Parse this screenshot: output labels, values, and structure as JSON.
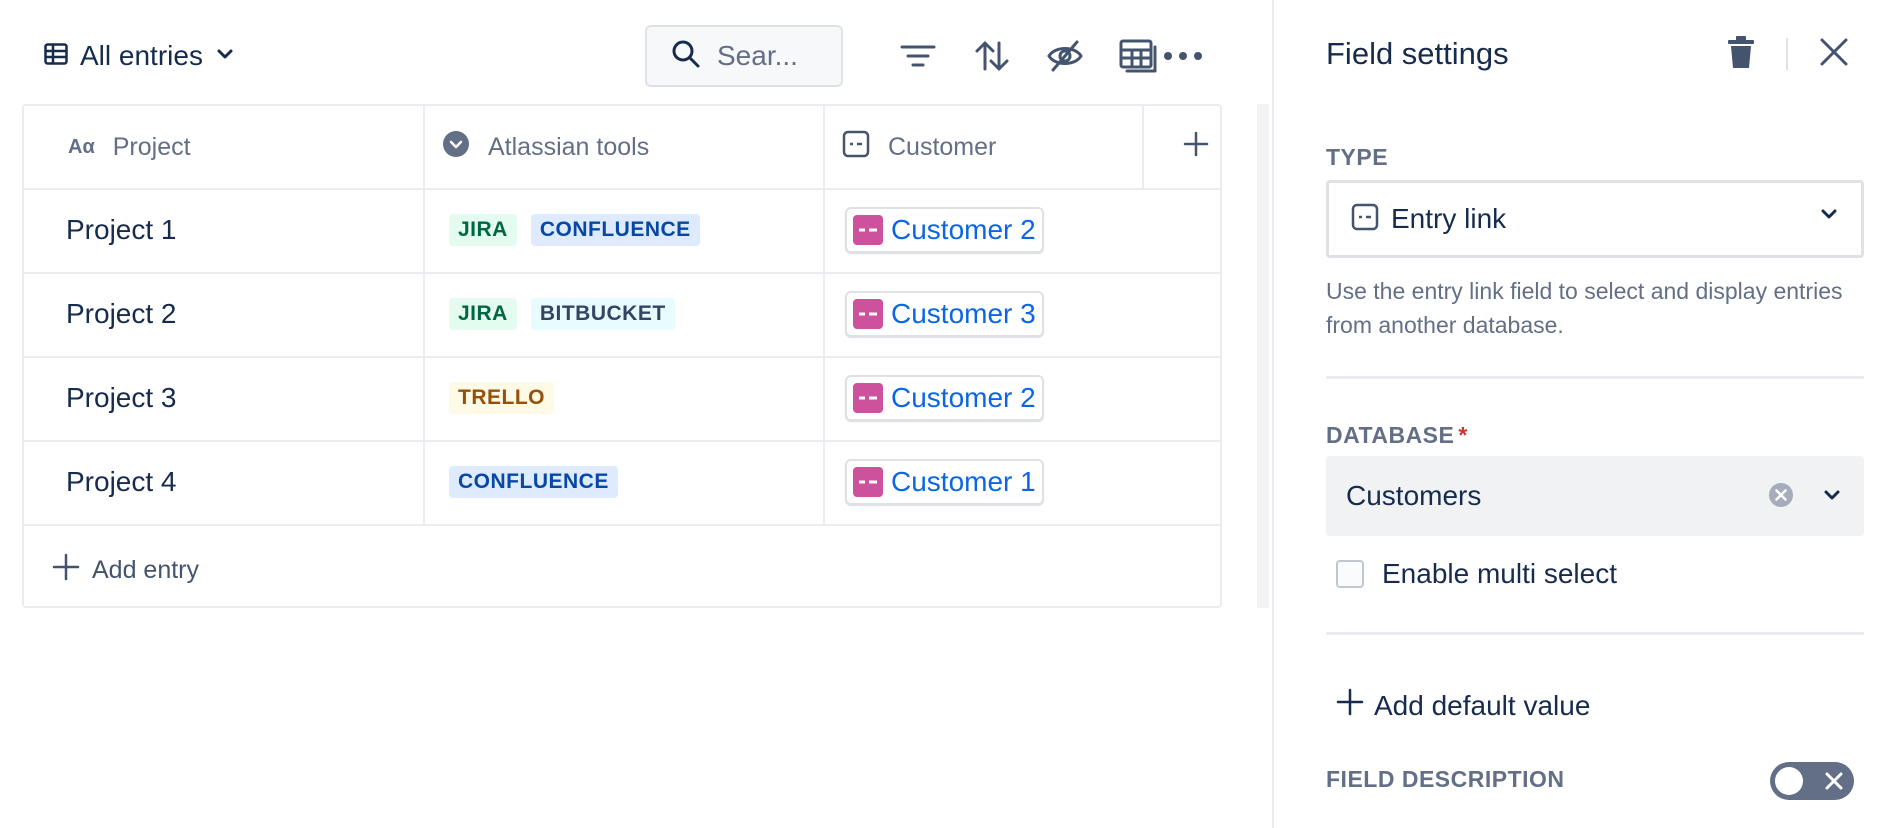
{
  "toolbar": {
    "view_label": "All entries",
    "search_placeholder": "Sear..."
  },
  "table": {
    "columns": [
      {
        "label": "Project",
        "icon": "text-type-icon",
        "icon_text": "Aα"
      },
      {
        "label": "Atlassian tools",
        "icon": "select-type-icon"
      },
      {
        "label": "Customer",
        "icon": "entry-link-icon"
      }
    ],
    "rows": [
      {
        "name": "Project 1",
        "tools": [
          "JIRA",
          "CONFLUENCE"
        ],
        "customer": "Customer 2"
      },
      {
        "name": "Project 2",
        "tools": [
          "JIRA",
          "BITBUCKET"
        ],
        "customer": "Customer 3"
      },
      {
        "name": "Project 3",
        "tools": [
          "TRELLO"
        ],
        "customer": "Customer 2"
      },
      {
        "name": "Project 4",
        "tools": [
          "CONFLUENCE"
        ],
        "customer": "Customer 1"
      }
    ],
    "add_entry_label": "Add entry"
  },
  "panel": {
    "title": "Field settings",
    "type_label": "TYPE",
    "type_value": "Entry link",
    "type_help": "Use the entry link field to select and display entries from another database.",
    "database_label": "DATABASE",
    "required_mark": "*",
    "database_value": "Customers",
    "multi_select_label": "Enable multi select",
    "add_default_label": "Add default value",
    "field_description_label": "FIELD DESCRIPTION"
  },
  "colors": {
    "primary_text": "#172B4D",
    "subtle_text": "#626F86",
    "link": "#0C66E4",
    "entry_chip_pink": "#CD519D",
    "required_red": "#C9372C"
  }
}
